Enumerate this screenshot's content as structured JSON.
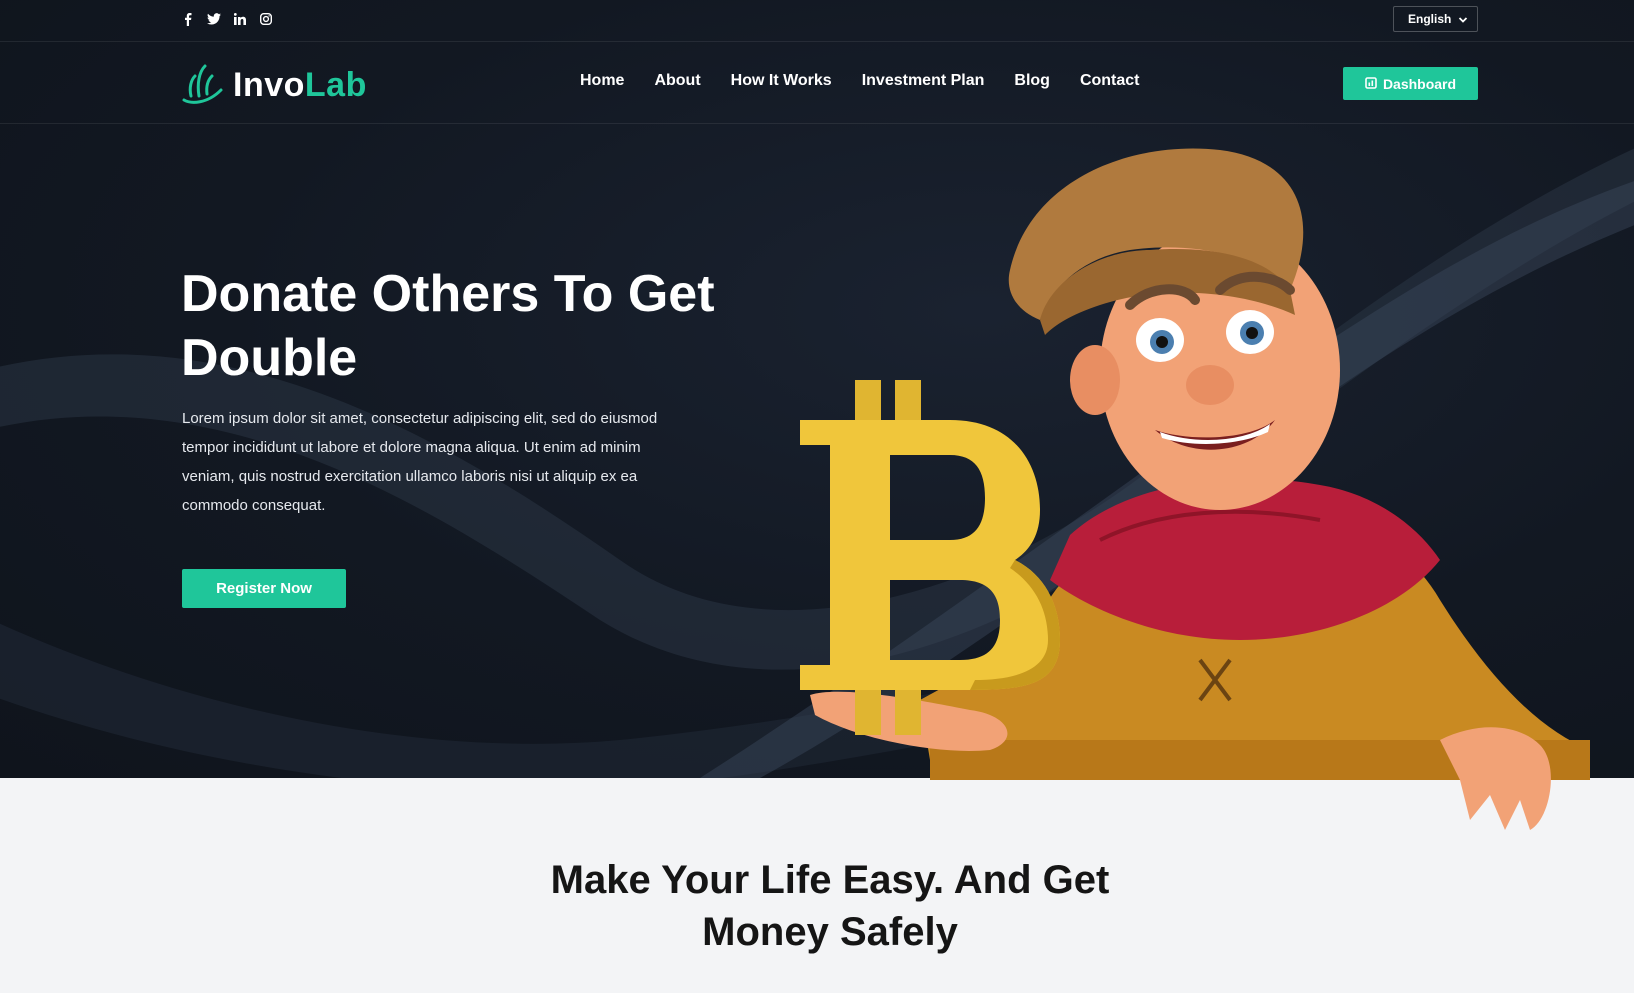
{
  "topbar": {
    "social": [
      "facebook-icon",
      "twitter-icon",
      "linkedin-icon",
      "instagram-icon"
    ],
    "language": "English"
  },
  "brand": {
    "name_part1": "Invo",
    "name_part2": "Lab"
  },
  "nav": {
    "items": [
      "Home",
      "About",
      "How It Works",
      "Investment Plan",
      "Blog",
      "Contact"
    ],
    "dashboard_label": "Dashboard"
  },
  "hero": {
    "title_line1": "Donate Others To Get",
    "title_line2": "Double",
    "text": "Lorem ipsum dolor sit amet, consectetur adipiscing elit, sed do eiusmod tempor incididunt ut labore et dolore magna aliqua. Ut enim ad minim veniam, quis nostrud exercitation ullamco laboris nisi ut aliquip ex ea commodo consequat.",
    "button_label": "Register Now",
    "illustration": "cartoon character holding bitcoin symbol"
  },
  "section": {
    "title_line1": "Make Your Life Easy. And Get",
    "title_line2": "Money Safely"
  },
  "colors": {
    "accent": "#1fc69a",
    "hero_bg": "#121822",
    "section_bg": "#f3f4f6",
    "heading_dark": "#151515"
  }
}
